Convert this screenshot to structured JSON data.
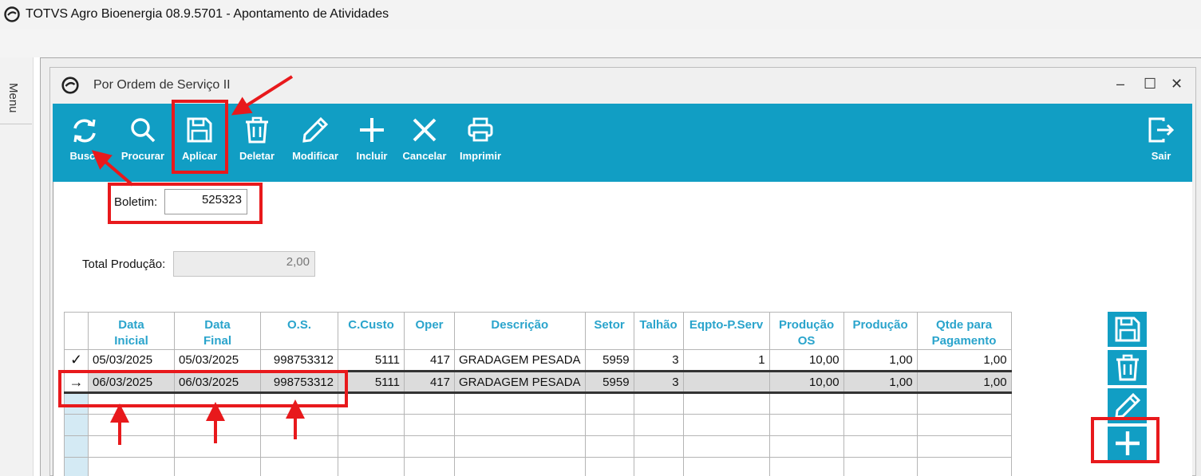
{
  "window": {
    "title": "TOTVS Agro Bioenergia 08.9.5701 - Apontamento de Atividades"
  },
  "side_menu": {
    "label": "Menu"
  },
  "child_window": {
    "title": "Por Ordem de Serviço II",
    "controls": {
      "minimize": "–",
      "maximize": "☐",
      "close": "✕"
    }
  },
  "toolbar": {
    "buttons": [
      {
        "label": "Busca",
        "icon": "refresh-icon"
      },
      {
        "label": "Procurar",
        "icon": "search-icon"
      },
      {
        "label": "Aplicar",
        "icon": "save-icon"
      },
      {
        "label": "Deletar",
        "icon": "trash-icon"
      },
      {
        "label": "Modificar",
        "icon": "pencil-icon"
      },
      {
        "label": "Incluir",
        "icon": "plus-icon"
      },
      {
        "label": "Cancelar",
        "icon": "x-icon"
      },
      {
        "label": "Imprimir",
        "icon": "printer-icon"
      },
      {
        "label": "Sair",
        "icon": "exit-icon"
      }
    ],
    "color": "#119ec4"
  },
  "form": {
    "boletim_label": "Boletim:",
    "boletim_value": "525323",
    "total_label": "Total Produção:",
    "total_value": "2,00"
  },
  "grid": {
    "columns": [
      {
        "l1": "Data",
        "l2": "Inicial"
      },
      {
        "l1": "Data",
        "l2": "Final"
      },
      {
        "l1": "O.S.",
        "l2": ""
      },
      {
        "l1": "C.Custo",
        "l2": ""
      },
      {
        "l1": "Oper",
        "l2": ""
      },
      {
        "l1": "Descrição",
        "l2": ""
      },
      {
        "l1": "Setor",
        "l2": ""
      },
      {
        "l1": "Talhão",
        "l2": ""
      },
      {
        "l1": "Eqpto-P.Serv",
        "l2": ""
      },
      {
        "l1": "Produção",
        "l2": "OS"
      },
      {
        "l1": "Produção",
        "l2": ""
      },
      {
        "l1": "Qtde para",
        "l2": "Pagamento"
      }
    ],
    "rows": [
      {
        "indicator": "✓",
        "data_inicial": "05/03/2025",
        "data_final": "05/03/2025",
        "os": "998753312",
        "c_custo": "5111",
        "oper": "417",
        "descricao": "GRADAGEM PESADA",
        "setor": "5959",
        "talhao": "3",
        "eqpto": "1",
        "producao_os": "10,00",
        "producao": "1,00",
        "qtde_pagamento": "1,00"
      },
      {
        "indicator": "→",
        "data_inicial": "06/03/2025",
        "data_final": "06/03/2025",
        "os": "998753312",
        "c_custo": "5111",
        "oper": "417",
        "descricao": "GRADAGEM PESADA",
        "setor": "5959",
        "talhao": "3",
        "eqpto": "",
        "producao_os": "10,00",
        "producao": "1,00",
        "qtde_pagamento": "1,00"
      }
    ]
  },
  "side_buttons": [
    {
      "icon": "save-icon"
    },
    {
      "icon": "trash-icon"
    },
    {
      "icon": "pencil-icon"
    },
    {
      "icon": "plus-icon"
    }
  ],
  "colors": {
    "accent": "#119ec4",
    "header_text": "#2aa4cc",
    "highlight": "#e8191c"
  }
}
